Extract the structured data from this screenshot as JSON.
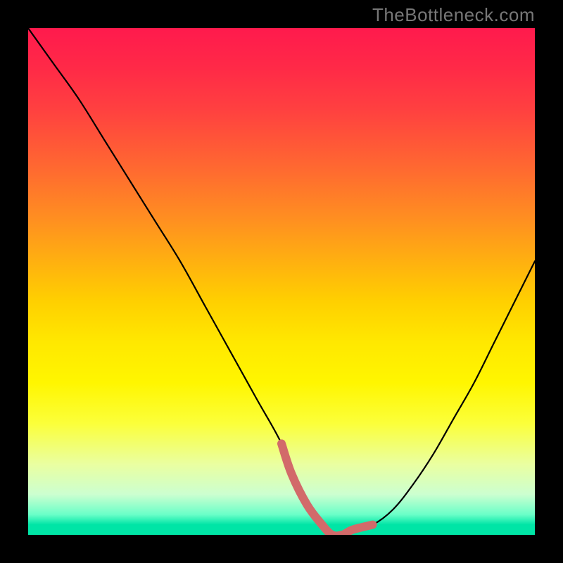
{
  "watermark": {
    "text": "TheBottleneck.com"
  },
  "colors": {
    "curve_stroke": "#000000",
    "basin_stroke": "#d26a6a",
    "gradient_top": "#ff1a4d",
    "gradient_bottom": "#00e5a6"
  },
  "chart_data": {
    "type": "line",
    "title": "",
    "xlabel": "",
    "ylabel": "",
    "xlim": [
      0,
      100
    ],
    "ylim": [
      0,
      100
    ],
    "series": [
      {
        "name": "bottleneck-curve",
        "x": [
          0,
          5,
          10,
          15,
          20,
          25,
          30,
          35,
          40,
          45,
          50,
          52,
          55,
          58,
          60,
          62,
          64,
          68,
          72,
          76,
          80,
          84,
          88,
          92,
          96,
          100
        ],
        "y": [
          100,
          93,
          86,
          78,
          70,
          62,
          54,
          45,
          36,
          27,
          18,
          12,
          6,
          2,
          0,
          0,
          1,
          2,
          5,
          10,
          16,
          23,
          30,
          38,
          46,
          54
        ]
      },
      {
        "name": "basin-highlight",
        "x": [
          50,
          52,
          55,
          58,
          60,
          62,
          64,
          68
        ],
        "y": [
          18,
          12,
          6,
          2,
          0,
          0,
          1,
          2
        ]
      }
    ],
    "basin_center_x": 61,
    "basin_floor_y": 0
  }
}
